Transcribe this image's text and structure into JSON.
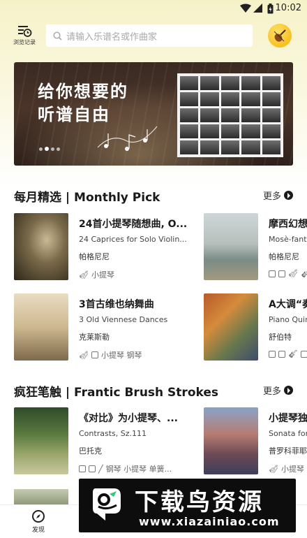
{
  "status_bar": {
    "time": "10:02"
  },
  "header": {
    "history_label": "浏览记录",
    "search_placeholder": "请输入乐谱名或作曲家",
    "avatar_icon": "violin-icon"
  },
  "banner": {
    "line1": "给你想要的",
    "line2": "听谱自由",
    "page_count": 4,
    "active_page": 2
  },
  "sections": [
    {
      "title": "每月精选 | Monthly Pick",
      "more": "更多",
      "cards": [
        {
          "name": "24首小提琴随想曲, O...",
          "en": "24 Caprices for Solo Violin...",
          "composer": "帕格尼尼",
          "instruments": "小提琴",
          "icons": [
            "violin-icon"
          ]
        },
        {
          "name": "摩西幻想",
          "en": "Mosè-fanta",
          "composer": "帕格尼尼",
          "instruments": "",
          "icons": [
            "score-icon",
            "recording-icon",
            "violin-icon",
            "guitar-icon"
          ]
        },
        {
          "name": "3首古维也纳舞曲",
          "en": "3 Old Viennese Dances",
          "composer": "克莱斯勒",
          "instruments": "小提琴 钢琴",
          "icons": [
            "violin-icon",
            "piano-icon"
          ]
        },
        {
          "name": "A大调“奏",
          "en": "Piano Quin",
          "composer": "舒伯特",
          "instruments": "",
          "icons": [
            "score-icon",
            "recording-icon",
            "guitar-icon",
            "piano-icon"
          ]
        }
      ]
    },
    {
      "title": "疯狂笔触 | Frantic Brush Strokes",
      "more": "更多",
      "cards": [
        {
          "name": "《对比》为小提琴、...",
          "en": "Contrasts, Sz.111",
          "composer": "巴托克",
          "instruments": "钢琴 小提琴 单簧...",
          "icons": [
            "score-icon",
            "recording-icon",
            "clarinet-icon"
          ]
        },
        {
          "name": "小提琴独",
          "en": "Sonata for",
          "composer": "普罗科菲耶",
          "instruments": "小提琴",
          "icons": [
            "violin-icon"
          ]
        }
      ]
    }
  ],
  "bottom_nav": [
    {
      "label": "发现",
      "icon": "compass-icon",
      "active": true
    },
    {
      "label": "",
      "icon": "library-icon",
      "active": false
    },
    {
      "label": "",
      "icon": "practice-icon",
      "active": false
    },
    {
      "label": "",
      "icon": "profile-icon",
      "active": false
    }
  ],
  "watermark": {
    "title": "下载鸟资源",
    "url": "www.xiazainiao.com"
  }
}
